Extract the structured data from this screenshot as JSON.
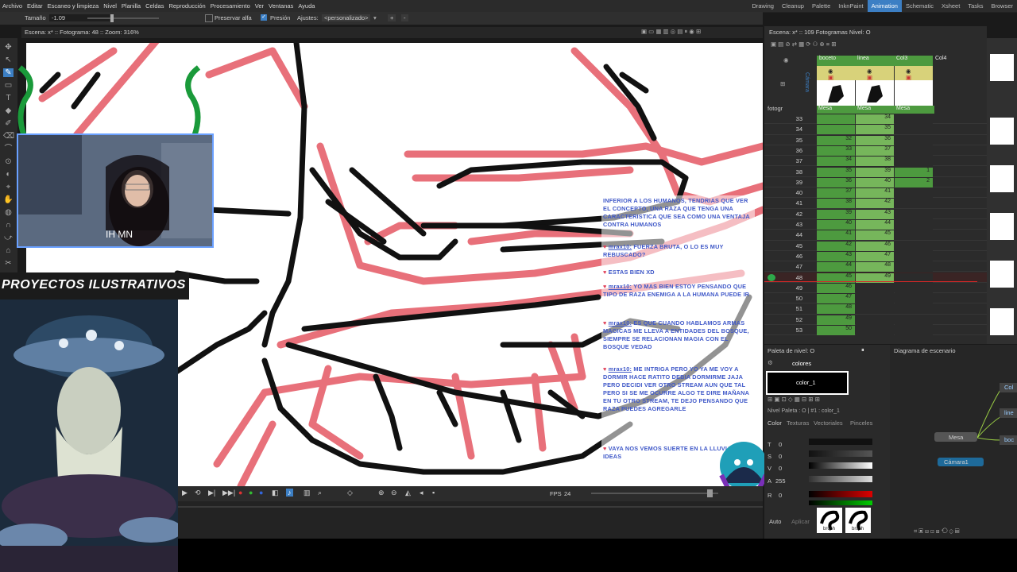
{
  "menu": [
    "Archivo",
    "Editar",
    "Escaneo y limpieza",
    "Nivel",
    "Planilla",
    "Celdas",
    "Reproducción",
    "Procesamiento",
    "Ver",
    "Ventanas",
    "Ayuda"
  ],
  "rooms": [
    "Drawing",
    "Cleanup",
    "Palette",
    "InknPaint",
    "Animation",
    "Schematic",
    "Xsheet",
    "Tasks",
    "Browser"
  ],
  "active_room": "Animation",
  "tool_options": {
    "size_label": "Tamaño",
    "size_value": "-1.09",
    "preserve_alpha": "Preservar alfa",
    "pressure": "Presión",
    "settings_label": "Ajustes:",
    "settings_value": "<personalizado>",
    "add": "+",
    "remove": "-"
  },
  "viewer": {
    "status": "Escena: x*  ::  Fotograma: 48  ::  Zoom: 316%"
  },
  "xsheet": {
    "header": "Escena: x*  ::  109 Fotogramas  Nivel: O",
    "camera_label": "Cámara",
    "fotogr_label": "fotogr",
    "columns": [
      {
        "name": "boceto",
        "pegbar": "Mesa"
      },
      {
        "name": "linea",
        "pegbar": "Mesa"
      },
      {
        "name": "Col3",
        "pegbar": "Mesa"
      },
      {
        "name": "Col4",
        "pegbar": ""
      }
    ],
    "rows": [
      {
        "n": "33",
        "a": "",
        "b": "34",
        "c": ""
      },
      {
        "n": "34",
        "a": "",
        "b": "35",
        "c": ""
      },
      {
        "n": "35",
        "a": "32",
        "b": "36",
        "c": ""
      },
      {
        "n": "36",
        "a": "33",
        "b": "37",
        "c": ""
      },
      {
        "n": "37",
        "a": "34",
        "b": "38",
        "c": ""
      },
      {
        "n": "38",
        "a": "35",
        "b": "39",
        "c": "1"
      },
      {
        "n": "39",
        "a": "36",
        "b": "40",
        "c": "2"
      },
      {
        "n": "40",
        "a": "37",
        "b": "41",
        "c": ""
      },
      {
        "n": "41",
        "a": "38",
        "b": "42",
        "c": ""
      },
      {
        "n": "42",
        "a": "39",
        "b": "43",
        "c": ""
      },
      {
        "n": "43",
        "a": "40",
        "b": "44",
        "c": ""
      },
      {
        "n": "44",
        "a": "41",
        "b": "45",
        "c": ""
      },
      {
        "n": "45",
        "a": "42",
        "b": "46",
        "c": ""
      },
      {
        "n": "46",
        "a": "43",
        "b": "47",
        "c": ""
      },
      {
        "n": "47",
        "a": "44",
        "b": "48",
        "c": ""
      },
      {
        "n": "48",
        "a": "45",
        "b": "49",
        "c": ""
      },
      {
        "n": "49",
        "a": "46",
        "b": "",
        "c": ""
      },
      {
        "n": "50",
        "a": "47",
        "b": "",
        "c": ""
      },
      {
        "n": "51",
        "a": "48",
        "b": "",
        "c": ""
      },
      {
        "n": "52",
        "a": "49",
        "b": "",
        "c": ""
      },
      {
        "n": "53",
        "a": "50",
        "b": "",
        "c": ""
      }
    ],
    "current_frame": "48"
  },
  "palette": {
    "title": "Paleta de nivel: O",
    "page": "colores",
    "selected_style": "color_1",
    "level_palette": "Nivel Paleta : O | #1 : color_1",
    "tabs": [
      "Color",
      "Texturas",
      "Vectoriales",
      "Pinceles"
    ],
    "channels": [
      {
        "label": "T",
        "value": "0"
      },
      {
        "label": "S",
        "value": "0"
      },
      {
        "label": "V",
        "value": "0"
      },
      {
        "label": "A",
        "value": "255"
      },
      {
        "label": "R",
        "value": "0"
      }
    ],
    "auto": "Auto",
    "apply": "Aplicar",
    "brushes": [
      "brush",
      "brush"
    ]
  },
  "schematic": {
    "title": "Diagrama de escenario",
    "nodes": [
      "Mesa",
      "Cámara1",
      "Col",
      "line",
      "boc"
    ]
  },
  "playback": {
    "fps_label": "FPS",
    "fps_value": "24"
  },
  "stream": {
    "banner": "PROYECTOS ILUSTRATIVOS",
    "webcam_text": "IH MN"
  },
  "chat": [
    {
      "user": "",
      "text": "INFERIOR A LOS HUMANOS, TENDRIAS QUE VER EL CONCEPTO, UNA RAZA QUE TENGA UNA CARACTERISTICA QUE SEA COMO UNA VENTAJA CONTRA HUMANOS"
    },
    {
      "user": "mrax10:",
      "text": "FUERZA BRUTA, O LO ES MUY REBUSCADO?"
    },
    {
      "user": "",
      "text": "ESTAS BIEN XD"
    },
    {
      "user": "mrax10:",
      "text": "YO MAS BIEN ESTOY PENSANDO QUE TIPO DE RAZA ENEMIGA A LA HUMANA PUEDE IR"
    },
    {
      "user": "mrax10:",
      "text": "ES QUE CUANDO HABLAMOS ARMAS MAGICAS ME LLEVA A ENTIDADES DEL BOSQUE, SIEMPRE SE RELACIONAN MAGIA CON EL BOSQUE VEDAD"
    },
    {
      "user": "mrax10:",
      "text": "ME INTRIGA PERO YO YA ME VOY A DORMIR HACE RATITO DEBIA DORMIRME JAJA PERO DECIDI VER OTRO STREAM AUN QUE TAL PERO SI SE ME OCURRE ALGO TE DIRE MAÑANA EN TU OTRO STREAM, TE DEJO PENSANDO QUE RAZA PUEDES AGREGARLE"
    },
    {
      "user": "",
      "text": "VAYA NOS VEMOS SUERTE EN LA LLUVIA DE IDEAS"
    }
  ],
  "colors": {
    "accent": "#3c7fc4",
    "xsheet_green": "#4d9a3f",
    "xsheet_green_light": "#76b65b",
    "current_row": "#d62828",
    "sketch_red": "#e8707a",
    "chat_blue": "#3f58c8"
  }
}
